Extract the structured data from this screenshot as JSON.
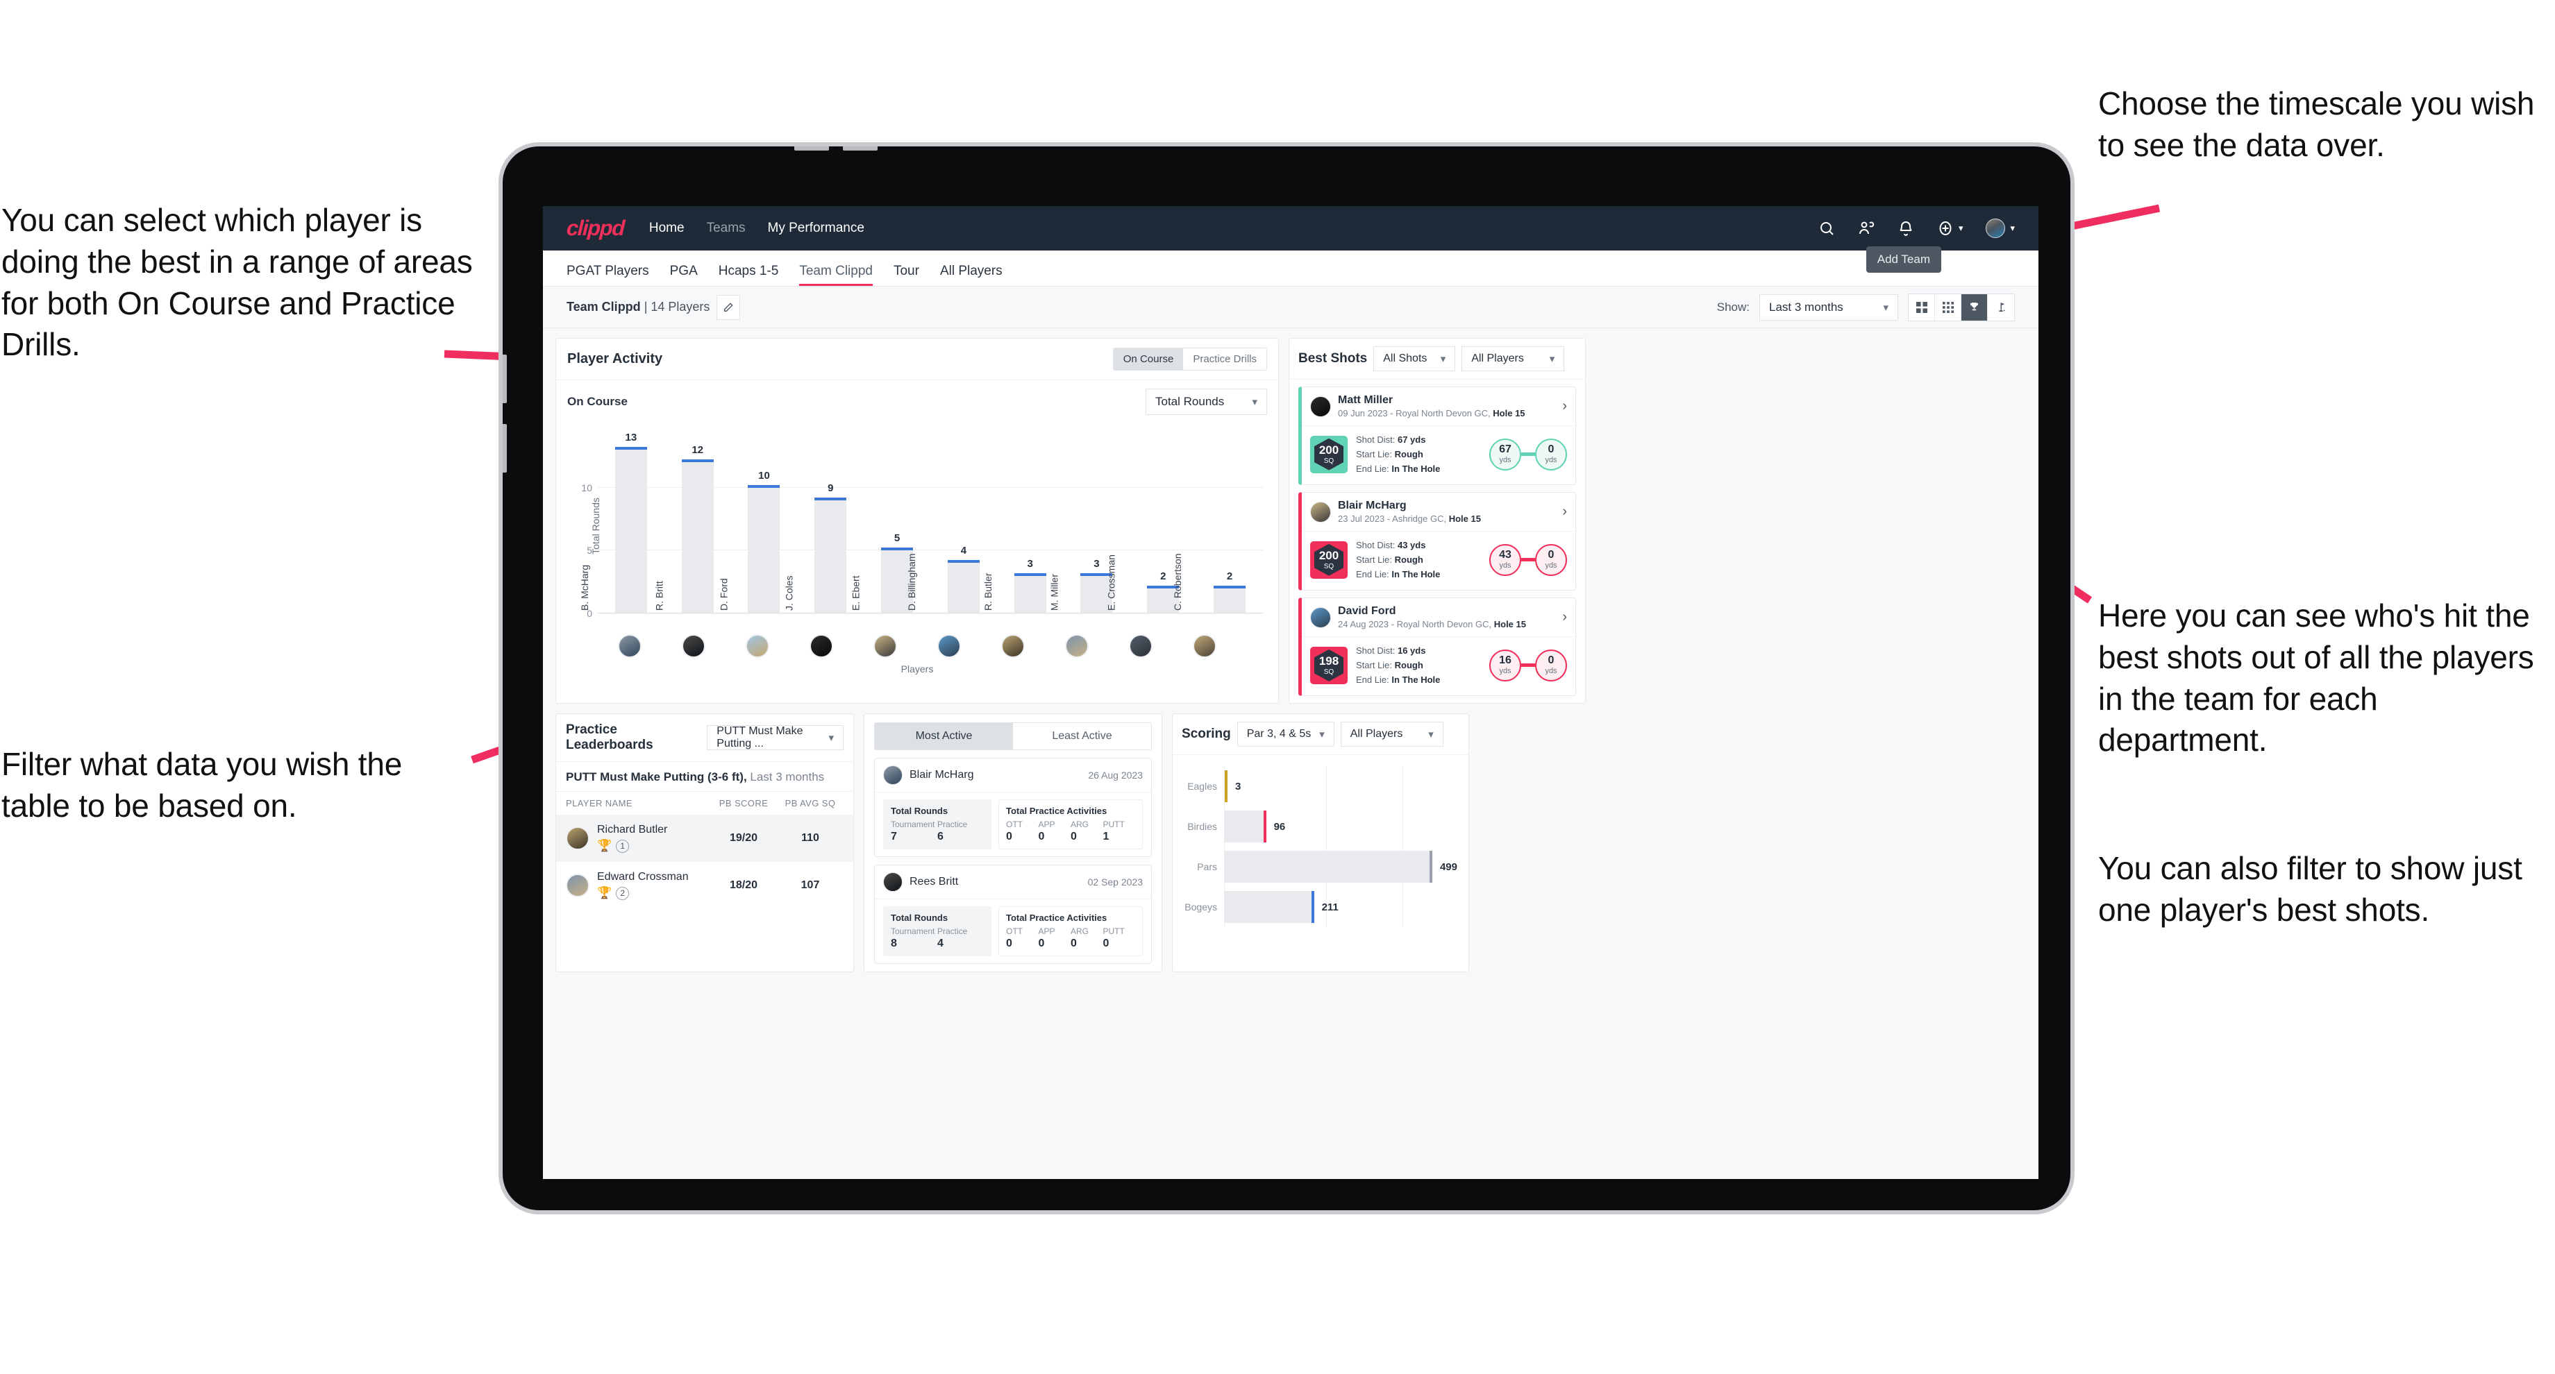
{
  "annotations": {
    "left_top": "You can select which player is doing the best in a range of areas for both On Course and Practice Drills.",
    "left_bottom": "Filter what data you wish the table to be based on.",
    "right_top": "Choose the timescale you wish to see the data over.",
    "right_middle": "Here you can see who's hit the best shots out of all the players in the team for each department.",
    "right_bottom": "You can also filter to show just one player's best shots."
  },
  "navbar": {
    "logo": "clippd",
    "links": [
      {
        "label": "Home",
        "active": true
      },
      {
        "label": "Teams",
        "active": false
      },
      {
        "label": "My Performance",
        "active": true
      }
    ],
    "icons": [
      "search-icon",
      "people-icon",
      "bell-icon",
      "plus-circle-icon",
      "avatar"
    ]
  },
  "tabs": {
    "items": [
      "PGAT Players",
      "PGA",
      "Hcaps 1-5",
      "Team Clippd",
      "Tour",
      "All Players"
    ],
    "active": "Team Clippd",
    "tooltip": "Add Team"
  },
  "subbar": {
    "team_name": "Team Clippd",
    "team_divider": " | ",
    "team_players": "14 Players",
    "edit_icon": "pencil-icon",
    "show_label": "Show:",
    "timescale_value": "Last 3 months",
    "view_icons": [
      "grid-2x2-icon",
      "grid-3x3-icon",
      "trophy-icon",
      "flag-icon"
    ],
    "view_active_index": 2
  },
  "player_activity": {
    "title": "Player Activity",
    "segments": [
      "On Course",
      "Practice Drills"
    ],
    "segment_active": "On Course",
    "subtitle": "On Course",
    "metric_value": "Total Rounds",
    "x_axis_label": "Players"
  },
  "chart_data": [
    {
      "type": "bar",
      "title": "Player Activity",
      "ylabel": "Total Rounds",
      "xlabel": "Players",
      "ylim": [
        0,
        14
      ],
      "yticks": [
        0,
        5,
        10
      ],
      "grid": true,
      "categories": [
        "B. McHarg",
        "R. Britt",
        "D. Ford",
        "J. Coles",
        "E. Ebert",
        "D. Billingham",
        "R. Butler",
        "M. Miller",
        "E. Crossman",
        "C. Robertson"
      ],
      "values": [
        13,
        12,
        10,
        9,
        5,
        4,
        3,
        3,
        2,
        2
      ]
    },
    {
      "type": "bar",
      "title": "Scoring",
      "orientation": "horizontal",
      "categories": [
        "Eagles",
        "Birdies",
        "Pars",
        "Bogeys"
      ],
      "values": [
        3,
        96,
        499,
        211
      ],
      "xlim": [
        0,
        560
      ],
      "grid": true
    }
  ],
  "best_shots": {
    "title": "Best Shots",
    "filter_shots": "All Shots",
    "filter_players": "All Players",
    "shots": [
      {
        "player": "Matt Miller",
        "meta_date": "09 Jun 2023 - Royal North Devon GC, ",
        "meta_hole": "Hole 15",
        "sq": "200",
        "sq_unit": "SQ",
        "accent": "teal",
        "dist_label": "Shot Dist: ",
        "dist_value": "67 yds",
        "start_label": "Start Lie: ",
        "start_value": "Rough",
        "end_label": "End Lie: ",
        "end_value": "In The Hole",
        "from_n": "67",
        "from_u": "yds",
        "to_n": "0",
        "to_u": "yds"
      },
      {
        "player": "Blair McHarg",
        "meta_date": "23 Jul 2023 - Ashridge GC, ",
        "meta_hole": "Hole 15",
        "sq": "200",
        "sq_unit": "SQ",
        "accent": "pink",
        "dist_label": "Shot Dist: ",
        "dist_value": "43 yds",
        "start_label": "Start Lie: ",
        "start_value": "Rough",
        "end_label": "End Lie: ",
        "end_value": "In The Hole",
        "from_n": "43",
        "from_u": "yds",
        "to_n": "0",
        "to_u": "yds"
      },
      {
        "player": "David Ford",
        "meta_date": "24 Aug 2023 - Royal North Devon GC, ",
        "meta_hole": "Hole 15",
        "sq": "198",
        "sq_unit": "SQ",
        "accent": "pink",
        "dist_label": "Shot Dist: ",
        "dist_value": "16 yds",
        "start_label": "Start Lie: ",
        "start_value": "Rough",
        "end_label": "End Lie: ",
        "end_value": "In The Hole",
        "from_n": "16",
        "from_u": "yds",
        "to_n": "0",
        "to_u": "yds"
      }
    ]
  },
  "practice_leaderboards": {
    "title": "Practice Leaderboards",
    "drill_select": "PUTT Must Make Putting ...",
    "subtitle_bold": "PUTT Must Make Putting (3-6 ft),",
    "subtitle_reg": " Last 3 months",
    "columns": [
      "PLAYER NAME",
      "PB SCORE",
      "PB AVG SQ"
    ],
    "rows": [
      {
        "name": "Richard Butler",
        "rank": "1",
        "trophy": "gold",
        "pb_score": "19/20",
        "pb_avg_sq": "110"
      },
      {
        "name": "Edward Crossman",
        "rank": "2",
        "trophy": "silver",
        "pb_score": "18/20",
        "pb_avg_sq": "107"
      }
    ]
  },
  "activity_panel": {
    "tabs": [
      "Most Active",
      "Least Active"
    ],
    "active_tab": "Most Active",
    "rounds_title": "Total Rounds",
    "rounds_keys": [
      "Tournament",
      "Practice"
    ],
    "practice_title": "Total Practice Activities",
    "practice_keys": [
      "OTT",
      "APP",
      "ARG",
      "PUTT"
    ],
    "cards": [
      {
        "name": "Blair McHarg",
        "date": "26 Aug 2023",
        "rounds": [
          "7",
          "6"
        ],
        "practice": [
          "0",
          "0",
          "0",
          "1"
        ]
      },
      {
        "name": "Rees Britt",
        "date": "02 Sep 2023",
        "rounds": [
          "8",
          "4"
        ],
        "practice": [
          "0",
          "0",
          "0",
          "0"
        ]
      }
    ]
  },
  "scoring": {
    "title": "Scoring",
    "filter_par": "Par 3, 4 & 5s",
    "filter_players": "All Players",
    "rows": [
      {
        "label": "Eagles",
        "value": "3",
        "color": "gold"
      },
      {
        "label": "Birdies",
        "value": "96",
        "color": "pink"
      },
      {
        "label": "Pars",
        "value": "499",
        "color": "gray"
      },
      {
        "label": "Bogeys",
        "value": "211",
        "color": "blue"
      }
    ]
  },
  "colors": {
    "brand": "#f0305a",
    "navbar": "#1e2a38",
    "bar": "#e8eaee",
    "bar_cap": "#3b78d8",
    "teal": "#5fd3b4"
  }
}
